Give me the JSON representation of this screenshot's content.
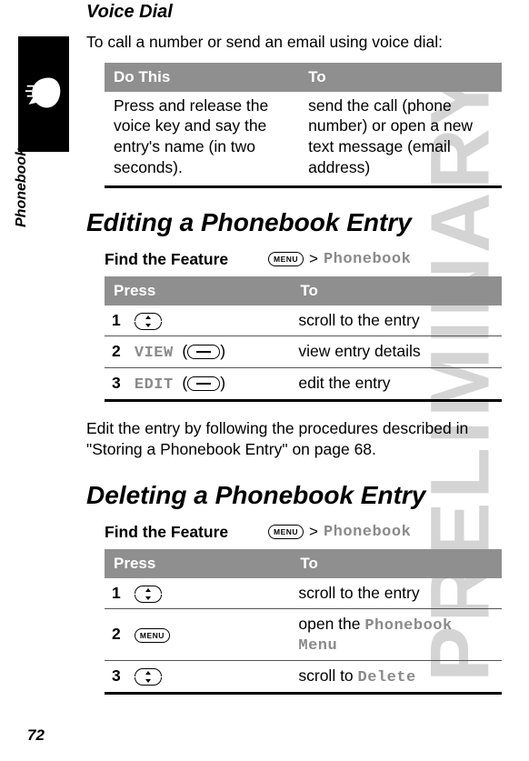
{
  "page": {
    "number": "72",
    "section_tab": "Phonebook",
    "watermark": "PRELIMINARY"
  },
  "voice_dial": {
    "heading": "Voice Dial",
    "intro": "To call a number or send an email using voice dial:",
    "table": {
      "headers": {
        "left": "Do This",
        "right": "To"
      },
      "row": {
        "left": "Press and release the voice key and say the entry's name (in two seconds).",
        "right": "send the call (phone number) or open a new text message (email address)"
      }
    }
  },
  "editing": {
    "heading": "Editing a Phonebook Entry",
    "find_label": "Find the Feature",
    "menu_key": "MENU",
    "gt": ">",
    "target": "Phonebook",
    "table": {
      "headers": {
        "left": "Press",
        "right": "To"
      },
      "rows": [
        {
          "num": "1",
          "press_icon": "updown",
          "press_label": "",
          "to": "scroll to the entry"
        },
        {
          "num": "2",
          "press_icon": "soft",
          "press_label": "VIEW",
          "to": "view entry details"
        },
        {
          "num": "3",
          "press_icon": "soft",
          "press_label": "EDIT",
          "to": "edit the entry"
        }
      ]
    },
    "followup": "Edit the entry by following the procedures described in \"Storing a Phonebook Entry\" on page 68."
  },
  "deleting": {
    "heading": "Deleting a Phonebook Entry",
    "find_label": "Find the Feature",
    "menu_key": "MENU",
    "gt": ">",
    "target": "Phonebook",
    "table": {
      "headers": {
        "left": "Press",
        "right": "To"
      },
      "rows": [
        {
          "num": "1",
          "press_icon": "updown",
          "press_label": "",
          "to": "scroll to the entry"
        },
        {
          "num": "2",
          "press_icon": "menu",
          "press_label": "MENU",
          "to_pre": "open the ",
          "to_mono": "Phonebook Menu"
        },
        {
          "num": "3",
          "press_icon": "updown",
          "press_label": "",
          "to_pre": "scroll to ",
          "to_mono": "Delete"
        }
      ]
    }
  }
}
